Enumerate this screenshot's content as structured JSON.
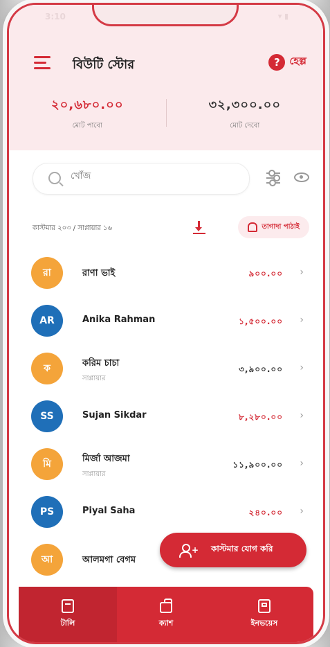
{
  "status_bar": {
    "time": "3:10",
    "icons": "▾ ▮"
  },
  "app_bar": {
    "title": "বিউটি স্টোর",
    "help_label": "হেল্প",
    "help_icon": "?"
  },
  "summary": {
    "left": {
      "value": "২০,৬৮০.০০",
      "label": "মোট পাবো"
    },
    "right": {
      "value": "৩২,৩০০.০০",
      "label": "মোট দেবো"
    }
  },
  "search": {
    "placeholder": "খোঁজ"
  },
  "list_meta": {
    "count_text": "কাস্টমার ২০৩ / সাপ্লায়ার ১৬",
    "reminder_label": "তাগাদা পাঠাই"
  },
  "customers": [
    {
      "initials": "রা",
      "name": "রাণা ভাই",
      "sub": "",
      "amount": "৯০০.০০",
      "amount_color": "red",
      "avatar_color": "orange"
    },
    {
      "initials": "AR",
      "name": "Anika Rahman",
      "sub": "",
      "amount": "১,৫০০.০০",
      "amount_color": "red",
      "avatar_color": "blue"
    },
    {
      "initials": "ক",
      "name": "করিম চাচা",
      "sub": "সাপ্লায়ার",
      "amount": "৩,৯০০.০০",
      "amount_color": "dark",
      "avatar_color": "orange"
    },
    {
      "initials": "SS",
      "name": "Sujan Sikdar",
      "sub": "",
      "amount": "৮,২৮০.০০",
      "amount_color": "red",
      "avatar_color": "blue"
    },
    {
      "initials": "মি",
      "name": "মির্জা আজমা",
      "sub": "সাপ্লায়ার",
      "amount": "১১,৯০০.০০",
      "amount_color": "dark",
      "avatar_color": "orange"
    },
    {
      "initials": "PS",
      "name": "Piyal Saha",
      "sub": "",
      "amount": "২৪০.০০",
      "amount_color": "red",
      "avatar_color": "blue"
    },
    {
      "initials": "আ",
      "name": "আলমগা বেগম",
      "sub": "",
      "amount": "",
      "amount_color": "red",
      "avatar_color": "orange"
    }
  ],
  "fab": {
    "label": "কাস্টমার যোগ করি"
  },
  "bottom_nav": [
    {
      "label": "টালি",
      "icon": "book-icon",
      "active": true
    },
    {
      "label": "ক্যাশ",
      "icon": "wallet-icon",
      "active": false
    },
    {
      "label": "ইনভয়েস",
      "icon": "register-icon",
      "active": false
    }
  ],
  "colors": {
    "primary": "#d42a35",
    "header_bg": "#fbeaec",
    "orange_avatar": "#f4a43a",
    "blue_avatar": "#1f6fb8"
  }
}
